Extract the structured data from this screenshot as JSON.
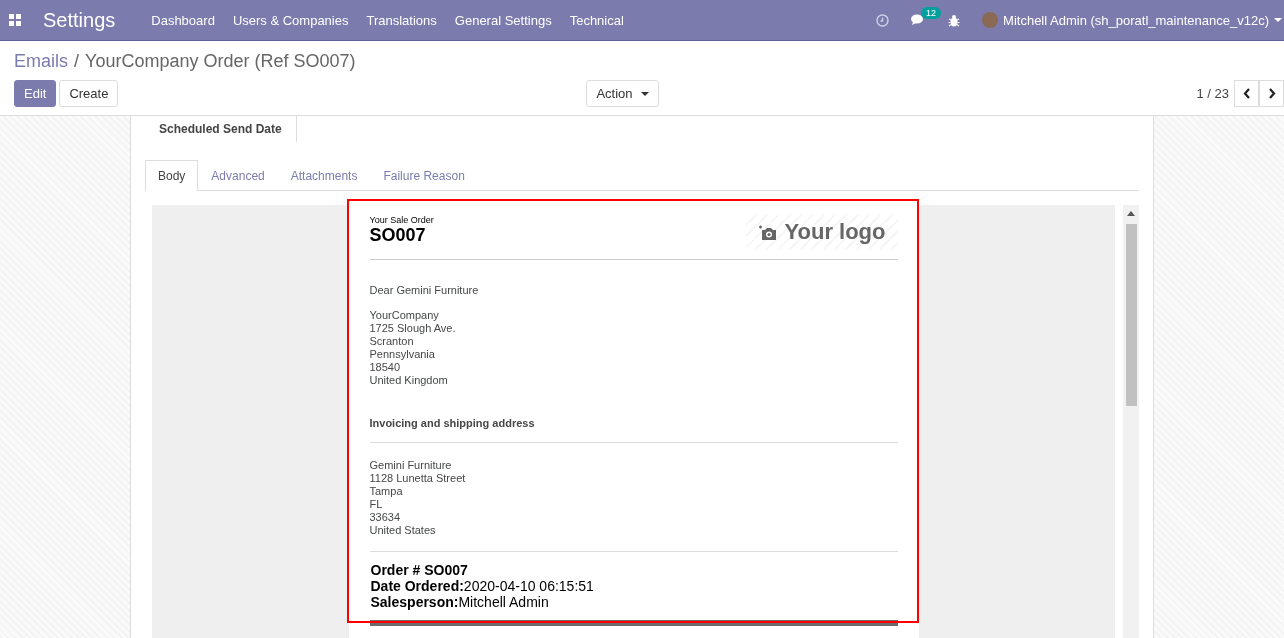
{
  "navbar": {
    "app_title": "Settings",
    "menu": [
      "Dashboard",
      "Users & Companies",
      "Translations",
      "General Settings",
      "Technical"
    ],
    "messages_count": "12",
    "user": "Mitchell Admin (sh_poratl_maintenance_v12c)"
  },
  "breadcrumb": [
    "Emails",
    "YourCompany Order (Ref SO007)"
  ],
  "breadcrumb_separator": "/",
  "buttons": [
    {
      "label": "Edit",
      "kind": "primary"
    },
    {
      "label": "Create",
      "kind": "secondary"
    }
  ],
  "action": "Action",
  "pager": "1 / 23",
  "form": {
    "field_label": "Scheduled Send Date",
    "tabs": [
      {
        "label": "Body",
        "selected": true
      },
      {
        "label": "Advanced",
        "selected": false
      },
      {
        "label": "Attachments",
        "selected": false
      },
      {
        "label": "Failure Reason",
        "selected": false
      }
    ]
  },
  "email": {
    "kicker": "Your Sale Order",
    "title": "SO007",
    "logo_text": "Your logo",
    "greeting": "Dear Gemini Furniture",
    "company_address": [
      "YourCompany",
      "1725 Slough Ave.",
      "Scranton",
      "Pennsylvania",
      "18540",
      "United Kingdom"
    ],
    "section_heading": "Invoicing and shipping address",
    "customer_address": [
      "Gemini Furniture",
      "1128 Lunetta Street",
      "Tampa",
      "FL",
      "33634",
      "United States"
    ],
    "order_lines": [
      "**Order # SO007**",
      "**Date Ordered:**2020-04-10 06:15:51",
      "**Salesperson:**Mitchell Admin"
    ]
  }
}
